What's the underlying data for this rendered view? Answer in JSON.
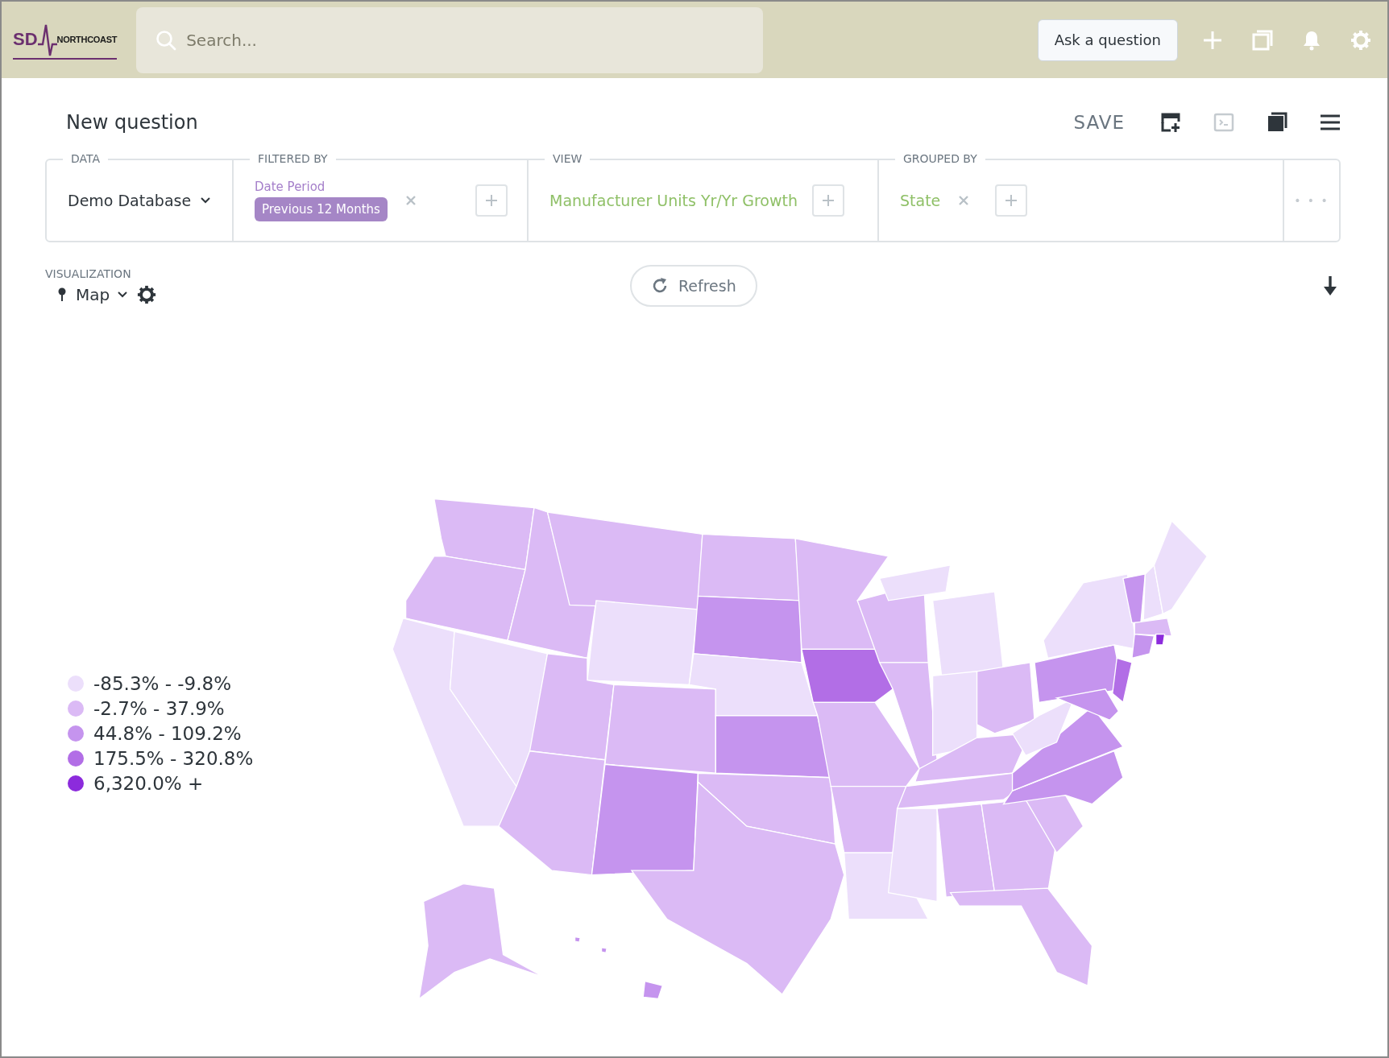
{
  "header": {
    "logo": {
      "mark": "SD",
      "name": "NORTHCOAST"
    },
    "search": {
      "placeholder": "Search..."
    },
    "ask_button": "Ask a question"
  },
  "question": {
    "title": "New question",
    "save": "SAVE"
  },
  "query": {
    "data": {
      "label": "DATA",
      "value": "Demo Database"
    },
    "filter": {
      "label": "FILTERED BY",
      "field": "Date Period",
      "value": "Previous 12 Months"
    },
    "view": {
      "label": "VIEW",
      "value": "Manufacturer Units Yr/Yr Growth"
    },
    "group": {
      "label": "GROUPED BY",
      "value": "State"
    },
    "more": "• • •"
  },
  "visualization": {
    "label": "VISUALIZATION",
    "type": "Map",
    "refresh": "Refresh"
  },
  "legend": [
    {
      "label": "-85.3% - -9.8%",
      "color": "#ecdffb"
    },
    {
      "label": "-2.7% - 37.9%",
      "color": "#dbbaf5"
    },
    {
      "label": "44.8% - 109.2%",
      "color": "#c594ee"
    },
    {
      "label": "175.5% - 320.8%",
      "color": "#b26ee6"
    },
    {
      "label": "6,320.0% +",
      "color": "#8c2bdc"
    }
  ]
}
